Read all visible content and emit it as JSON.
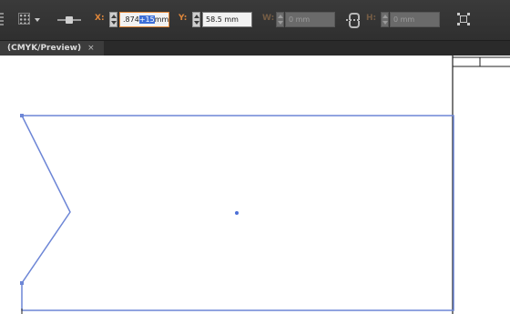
{
  "control_bar": {
    "x_label": "X:",
    "x_value_prefix": ".874",
    "x_value_selected": "+15",
    "x_value_suffix": "mm",
    "y_label": "Y:",
    "y_value": "58.5 mm",
    "w_label": "W:",
    "w_value": "0 mm",
    "h_label": "H:",
    "h_value": "0 mm",
    "icons": [
      "panel-grip-icon",
      "reference-point-icon",
      "constrain-icon",
      "link-proportions-icon",
      "transform-icon"
    ]
  },
  "document_tab": {
    "title": "(CMYK/Preview)",
    "close": "×"
  },
  "colors": {
    "control_bar_bg": "#333333",
    "label_orange": "#e0873a",
    "selection_blue": "#3d6fd8",
    "path_stroke": "#6d86d6",
    "canvas_bg": "#ffffff"
  }
}
